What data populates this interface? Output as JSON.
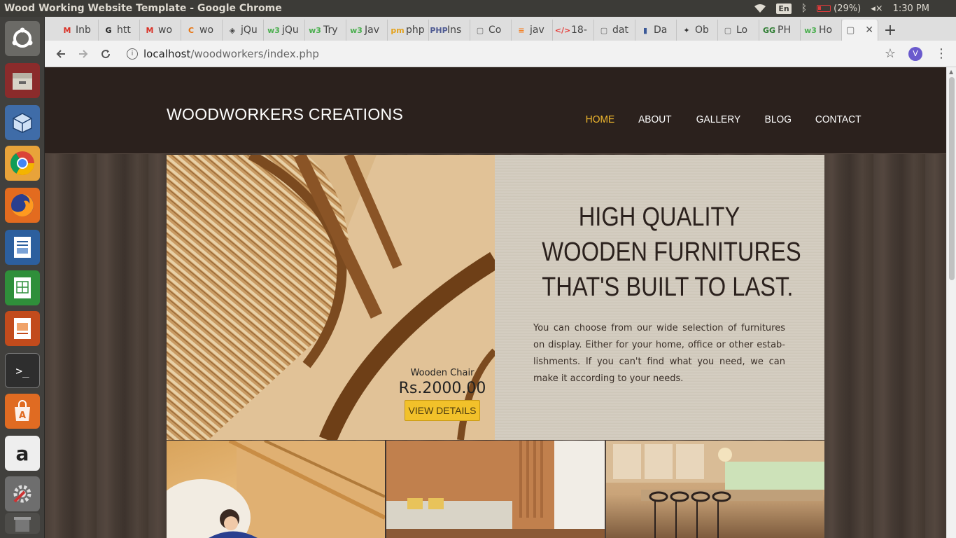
{
  "os": {
    "window_title": "Wood Working Website Template - Google Chrome",
    "tray": {
      "lang": "En",
      "battery": "(29%)",
      "time": "1:30 PM"
    }
  },
  "browser": {
    "tabs": [
      {
        "label": "Inb",
        "icon": "gmail-icon",
        "glyph": "M",
        "color": "#d93025"
      },
      {
        "label": "htt",
        "icon": "github-icon",
        "glyph": "G",
        "color": "#222222"
      },
      {
        "label": "wo",
        "icon": "gmail-icon",
        "glyph": "M",
        "color": "#d93025"
      },
      {
        "label": "wo",
        "icon": "c-icon",
        "glyph": "C",
        "color": "#e8710a"
      },
      {
        "label": "jQu",
        "icon": "diamond-icon",
        "glyph": "◈",
        "color": "#444444"
      },
      {
        "label": "jQu",
        "icon": "w3-icon",
        "glyph": "w3",
        "color": "#4caf50"
      },
      {
        "label": "Try",
        "icon": "w3-icon",
        "glyph": "w3",
        "color": "#4caf50"
      },
      {
        "label": "Jav",
        "icon": "w3-icon",
        "glyph": "w3",
        "color": "#4caf50"
      },
      {
        "label": "php",
        "icon": "phpmyadmin-icon",
        "glyph": "pm",
        "color": "#e4a11b"
      },
      {
        "label": "Ins",
        "icon": "php-icon",
        "glyph": "PHP",
        "color": "#4f5b93"
      },
      {
        "label": "Co",
        "icon": "page-icon",
        "glyph": "▢",
        "color": "#666666"
      },
      {
        "label": "jav",
        "icon": "stackoverflow-icon",
        "glyph": "≡",
        "color": "#f48024"
      },
      {
        "label": "18-",
        "icon": "code-icon",
        "glyph": "</>",
        "color": "#e53935"
      },
      {
        "label": "dat",
        "icon": "page-icon",
        "glyph": "▢",
        "color": "#666666"
      },
      {
        "label": "Da",
        "icon": "chart-icon",
        "glyph": "▮",
        "color": "#3b5998"
      },
      {
        "label": "Ob",
        "icon": "bird-icon",
        "glyph": "✦",
        "color": "#333333"
      },
      {
        "label": "Lo",
        "icon": "page-icon",
        "glyph": "▢",
        "color": "#666666"
      },
      {
        "label": "PH",
        "icon": "gg-icon",
        "glyph": "GG",
        "color": "#2e7d32"
      },
      {
        "label": "Ho",
        "icon": "w3-icon",
        "glyph": "w3",
        "color": "#4caf50"
      }
    ],
    "url_host": "localhost",
    "url_path": "/woodworkers/index.php",
    "profile_initial": "V"
  },
  "site": {
    "brand": "WOODWORKERS CREATIONS",
    "nav": [
      "HOME",
      "ABOUT",
      "GALLERY",
      "BLOG",
      "CONTACT"
    ],
    "nav_active": "HOME",
    "accent": "#f2b92e",
    "hero": {
      "headline": [
        "HIGH QUALITY",
        "WOODEN FURNITURES",
        "THAT'S BUILT TO LAST."
      ],
      "blurb": "You can choose from our wide selection of furnitures on display. Either for your home, office or other estab-lishments. If you can't find what you need, we can make it according to your needs.",
      "product_name": "Wooden Chair",
      "product_price": "Rs.2000.00",
      "cta": "VIEW DETAILS"
    }
  }
}
